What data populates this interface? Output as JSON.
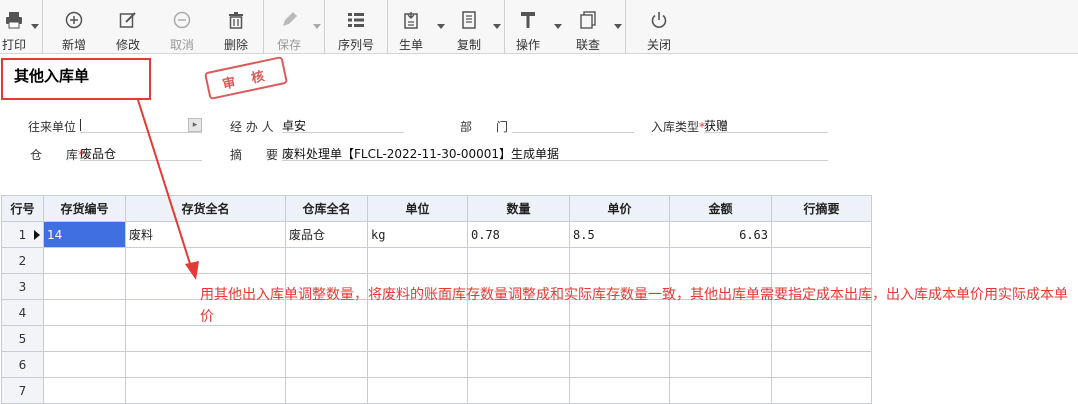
{
  "toolbar": {
    "buttons": [
      {
        "label": "打印",
        "icon": "printer-icon"
      },
      {
        "label": "新增",
        "icon": "plus-circle-icon"
      },
      {
        "label": "修改",
        "icon": "edit-icon"
      },
      {
        "label": "取消",
        "icon": "minus-circle-icon"
      },
      {
        "label": "删除",
        "icon": "trash-icon"
      },
      {
        "label": "保存",
        "icon": "pen-icon"
      },
      {
        "label": "序列号",
        "icon": "grid-icon"
      },
      {
        "label": "生单",
        "icon": "generate-doc-icon"
      },
      {
        "label": "复制",
        "icon": "copy-doc-icon"
      },
      {
        "label": "操作",
        "icon": "tool-icon"
      },
      {
        "label": "联查",
        "icon": "linked-query-icon"
      },
      {
        "label": "关闭",
        "icon": "power-icon"
      }
    ]
  },
  "form": {
    "title": "其他入库单",
    "stamp": "审 核",
    "labels": {
      "partner": "往来单位",
      "handler": "经 办 人",
      "dept": "部　　门",
      "in_type": "入库类型",
      "warehouse": "仓　　库",
      "summary": "摘　　要"
    },
    "values": {
      "partner": "",
      "handler": "卓安",
      "dept": "",
      "in_type": "获赠",
      "warehouse": "废品仓",
      "summary": "废料处理单【FLCL-2022-11-30-00001】生成单据"
    },
    "required_mark": "*"
  },
  "grid": {
    "headers": [
      "行号",
      "存货编号",
      "存货全名",
      "仓库全名",
      "单位",
      "数量",
      "单价",
      "金额",
      "行摘要"
    ],
    "rows": [
      [
        "1",
        "14",
        "废料",
        "废品仓",
        "kg",
        "0.78",
        "8.5",
        "6.63",
        ""
      ],
      [
        "2",
        "",
        "",
        "",
        "",
        "",
        "",
        "",
        ""
      ],
      [
        "3",
        "",
        "",
        "",
        "",
        "",
        "",
        "",
        ""
      ],
      [
        "4",
        "",
        "",
        "",
        "",
        "",
        "",
        "",
        ""
      ],
      [
        "5",
        "",
        "",
        "",
        "",
        "",
        "",
        "",
        ""
      ],
      [
        "6",
        "",
        "",
        "",
        "",
        "",
        "",
        "",
        ""
      ],
      [
        "7",
        "",
        "",
        "",
        "",
        "",
        "",
        "",
        ""
      ]
    ]
  },
  "annotation": {
    "text": "用其他出入库单调整数量，将废料的账面库存数量调整成和实际库存数量一致，其他出库单需要指定成本出库，出入库成本单价用实际成本单价",
    "color": "#e53935"
  }
}
